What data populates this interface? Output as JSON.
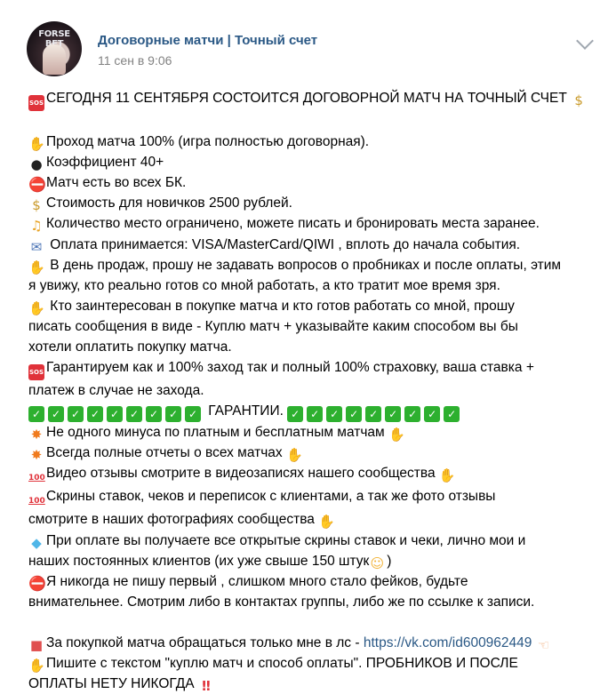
{
  "header": {
    "avatar_text": "FORSE BET",
    "title": "Договорные матчи | Точный счет",
    "date": "11 сен в 9:06"
  },
  "icons": {
    "sos": "SOS",
    "bag": "money-bag",
    "hand": "hand",
    "bomb": "bomb",
    "stop": "no-entry",
    "bell": "bell",
    "mail": "mailbox",
    "raise": "raised-hand",
    "check": "check-mark",
    "boom": "collision",
    "hundred": "hundred-points",
    "gem": "gem",
    "wink": "winking-face",
    "gift": "gift",
    "point": "pointing-left",
    "bang": "double-exclamation"
  },
  "glyphs": {
    "sos": "SOS",
    "bag": "$",
    "hand": "✋",
    "bomb": "●",
    "stop": "⛔",
    "bell": "♫",
    "mail": "✉",
    "raise": "✋",
    "check": "✓",
    "boom": "✸",
    "hundred": "100",
    "gem": "◆",
    "wink": "☺",
    "gift": "■",
    "point": "☜",
    "bang": "‼"
  },
  "post": {
    "headline": "СЕГОДНЯ 11 СЕНТЯБРЯ СОСТОИТСЯ ДОГОВОРНОЙ МАТЧ НА ТОЧНЫЙ СЧЕТ",
    "l1": "Проход матча 100% (игра полностью договорная).",
    "l2": "Коэффициент 40+",
    "l3": "Матч есть во всех БК.",
    "l4": "Стоимость для новичков 2500 рублей.",
    "l5": "Количество место ограничено, можете писать и бронировать места заранее.",
    "l6": " Оплата принимается: VISA/MasterCard/QIWI , вплоть до начала события.",
    "l7a": " В день продаж, прошу не задавать вопросов о пробниках и после оплаты, этим",
    "l7b": "я увижу, кто реально готов со мной работать, а кто тратит мое время зря.",
    "l8a": " Кто заинтересован в покупке матча и кто готов работать со мной, прошу",
    "l8b": "писать сообщения в виде - Куплю матч + указывайте каким способом вы бы",
    "l8c": "хотели оплатить покупку матча.",
    "l9a": "Гарантируем как и 100% заход так и полный 100% страховку, ваша ставка +",
    "l9b": "платеж в случае не захода.",
    "guarantee": " ГАРАНТИИ. ",
    "l10": "Не одного минуса по платным и бесплатным матчам",
    "l11": "Всегда полные отчеты о всех матчах",
    "l12": "Видео отзывы смотрите в видеозаписях нашего сообщества",
    "l13a": "Скрины ставок, чеков и переписок с клиентами, а так же фото отзывы",
    "l13b": "смотрите в наших фотографиях сообщества",
    "l14a": "При оплате вы получаете все открытые скрины ставок и чеки, лично мои и",
    "l14b": "наших постоянных клиентов (их уже свыше 150 штук",
    "l14c": ")",
    "l15a": "Я никогда не пишу первый , слишком много стало фейков, будьте",
    "l15b": "внимательнее. Смотрим либо в контактах группы, либо же по ссылке к записи.",
    "l16": "За покупкой матча обращаться только мне в лс - ",
    "link": "https://vk.com/id600962449",
    "l17a": "Пишите с текстом \"куплю матч и способ оплаты\". ПРОБНИКОВ И ПОСЛЕ",
    "l17b": "ОПЛАТЫ НЕТУ НИКОГДА"
  }
}
